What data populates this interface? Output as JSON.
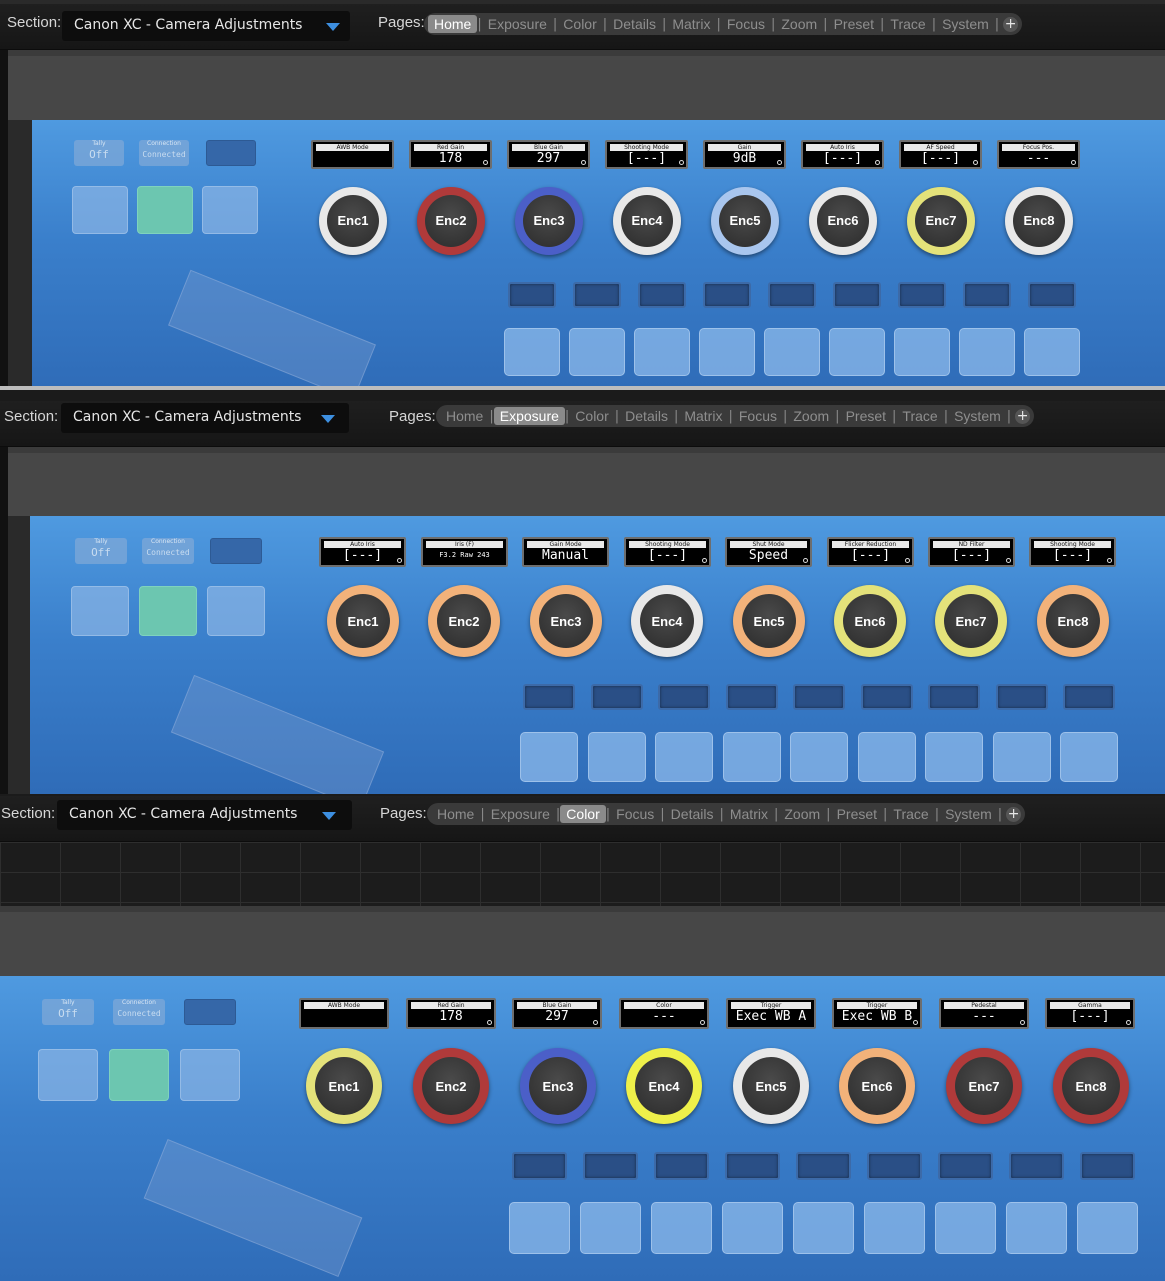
{
  "section_label": "Section:",
  "pages_label": "Pages:",
  "panels": [
    {
      "section_value": "Canon XC - Camera Adjustments",
      "tabs": [
        "Home",
        "Exposure",
        "Color",
        "Details",
        "Matrix",
        "Focus",
        "Zoom",
        "Preset",
        "Trace",
        "System"
      ],
      "active_tab": "Home",
      "plus": "+",
      "ghost_tally_title": "Tally",
      "ghost_tally_value": "Off",
      "ghost_connection_title": "Connection",
      "ghost_connection_value": "Connected",
      "displays": [
        {
          "title": "AWB Mode",
          "value": ""
        },
        {
          "title": "Red Gain",
          "value": "178"
        },
        {
          "title": "Blue Gain",
          "value": "297"
        },
        {
          "title": "Shooting Mode",
          "value": "[---]"
        },
        {
          "title": "Gain",
          "value": "9dB"
        },
        {
          "title": "Auto Iris",
          "value": "[---]"
        },
        {
          "title": "AF Speed",
          "value": "[---]"
        },
        {
          "title": "Focus Pos.",
          "value": "---"
        }
      ],
      "encoders": [
        "Enc1",
        "Enc2",
        "Enc3",
        "Enc4",
        "Enc5",
        "Enc6",
        "Enc7",
        "Enc8"
      ],
      "ring_colors": [
        "#e8e8e8",
        "#b03a3a",
        "#4b5fc8",
        "#e8e8e8",
        "#a9c6ee",
        "#e8e8e8",
        "#e4e27a",
        "#e8e8e8"
      ]
    },
    {
      "section_value": "Canon XC - Camera Adjustments",
      "tabs": [
        "Home",
        "Exposure",
        "Color",
        "Details",
        "Matrix",
        "Focus",
        "Zoom",
        "Preset",
        "Trace",
        "System"
      ],
      "active_tab": "Exposure",
      "plus": "+",
      "ghost_tally_title": "Tally",
      "ghost_tally_value": "Off",
      "ghost_connection_title": "Connection",
      "ghost_connection_value": "Connected",
      "displays": [
        {
          "title": "Auto Iris",
          "value": "[---]"
        },
        {
          "title": "Iris (F)",
          "value": "F3.2 Raw 243"
        },
        {
          "title": "Gain Mode",
          "value": "Manual"
        },
        {
          "title": "Shooting Mode",
          "value": "[---]"
        },
        {
          "title": "Shut Mode",
          "value": "Speed"
        },
        {
          "title": "Flicker Reduction",
          "value": "[---]"
        },
        {
          "title": "ND Filter",
          "value": "[---]"
        },
        {
          "title": "Shooting Mode",
          "value": "[---]"
        }
      ],
      "encoders": [
        "Enc1",
        "Enc2",
        "Enc3",
        "Enc4",
        "Enc5",
        "Enc6",
        "Enc7",
        "Enc8"
      ],
      "ring_colors": [
        "#f2b27a",
        "#f2b27a",
        "#f2b27a",
        "#e8e8e8",
        "#f2b27a",
        "#e4e27a",
        "#e4e27a",
        "#f2b27a"
      ]
    },
    {
      "section_value": "Canon XC - Camera Adjustments",
      "tabs": [
        "Home",
        "Exposure",
        "Color",
        "Focus",
        "Details",
        "Matrix",
        "Zoom",
        "Preset",
        "Trace",
        "System"
      ],
      "active_tab": "Color",
      "plus": "+",
      "ghost_tally_title": "Tally",
      "ghost_tally_value": "Off",
      "ghost_connection_title": "Connection",
      "ghost_connection_value": "Connected",
      "displays": [
        {
          "title": "AWB Mode",
          "value": ""
        },
        {
          "title": "Red Gain",
          "value": "178"
        },
        {
          "title": "Blue Gain",
          "value": "297"
        },
        {
          "title": "Color",
          "value": "---"
        },
        {
          "title": "Trigger",
          "value": "Exec WB A"
        },
        {
          "title": "Trigger",
          "value": "Exec WB B"
        },
        {
          "title": "Pedestal",
          "value": "---"
        },
        {
          "title": "Gamma",
          "value": "[---]"
        }
      ],
      "encoders": [
        "Enc1",
        "Enc2",
        "Enc3",
        "Enc4",
        "Enc5",
        "Enc6",
        "Enc7",
        "Enc8"
      ],
      "ring_colors": [
        "#e4e27a",
        "#b03a3a",
        "#4b5fc8",
        "#eef04a",
        "#e8e8e8",
        "#f2b27a",
        "#b03a3a",
        "#b03a3a"
      ]
    }
  ]
}
